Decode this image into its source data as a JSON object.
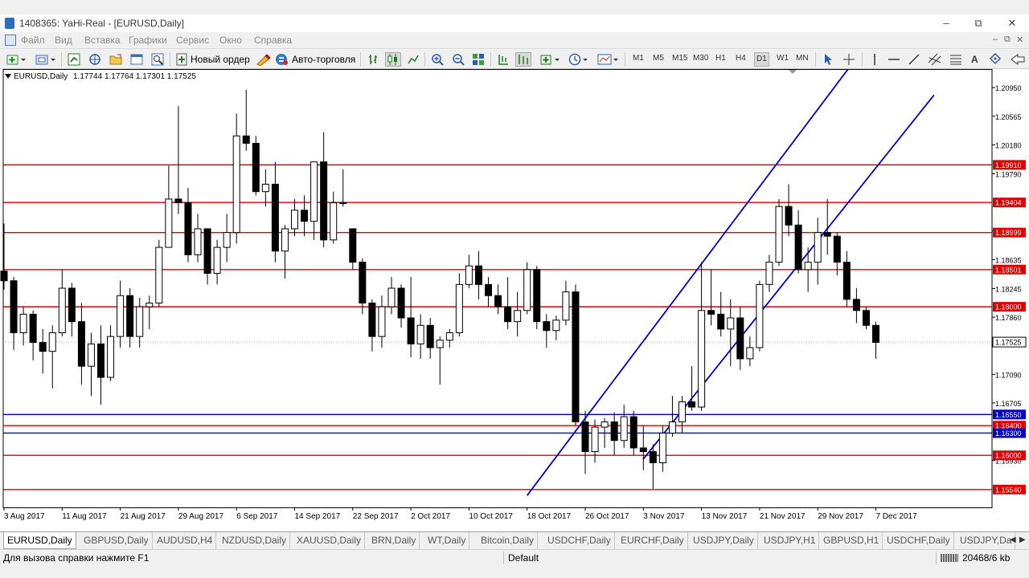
{
  "window": {
    "title": "1408365: YaHi-Real - [EURUSD,Daily]",
    "controls": [
      "–",
      "⧉",
      "✕"
    ]
  },
  "menu": [
    "Файл",
    "Вид",
    "Вставка",
    "Графики",
    "Сервис",
    "Окно",
    "Справка"
  ],
  "mdi_controls": [
    "–",
    "⧉",
    "✕"
  ],
  "toolbar": {
    "new_order_label": "Новый ордер",
    "auto_trading_label": "Авто-торговля",
    "timeframes": [
      "M1",
      "M5",
      "M15",
      "M30",
      "H1",
      "H4",
      "D1",
      "W1",
      "MN"
    ],
    "active_timeframe": "D1"
  },
  "chart_header": {
    "symbol_period": "EURUSD,Daily",
    "ohlc": "1.17744 1.17764 1.17301 1.17525"
  },
  "colors": {
    "bull_candle": "#ffffff",
    "bear_candle": "#000000",
    "support_resistance": "#e00000",
    "channel": "#0000c8",
    "current_price_label": "#0000c8"
  },
  "chart_data": {
    "type": "candlestick",
    "symbol": "EURUSD",
    "period": "Daily",
    "y_range": [
      1.153,
      1.212
    ],
    "price_axis_ticks": [
      "1.20950",
      "1.20565",
      "1.20180",
      "1.19790",
      "1.19020",
      "1.18635",
      "1.18245",
      "1.17860",
      "1.17090",
      "1.16705",
      "1.15930"
    ],
    "date_labels": [
      "3 Aug 2017",
      "11 Aug 2017",
      "21 Aug 2017",
      "29 Aug 2017",
      "6 Sep 2017",
      "14 Sep 2017",
      "22 Sep 2017",
      "2 Oct 2017",
      "10 Oct 2017",
      "18 Oct 2017",
      "26 Oct 2017",
      "3 Nov 2017",
      "13 Nov 2017",
      "21 Nov 2017",
      "29 Nov 2017",
      "7 Dec 2017"
    ],
    "horizontal_levels": [
      {
        "label": "1.19910",
        "value": 1.1991,
        "color": "red"
      },
      {
        "label": "1.19404",
        "value": 1.19404,
        "color": "red"
      },
      {
        "label": "1.18999",
        "value": 1.18999,
        "color": "red"
      },
      {
        "label": "1.18501",
        "value": 1.18501,
        "color": "red"
      },
      {
        "label": "1.18000",
        "value": 1.18,
        "color": "red"
      },
      {
        "label": "1.16550",
        "value": 1.1655,
        "color": "blue"
      },
      {
        "label": "1.16400",
        "value": 1.164,
        "color": "red"
      },
      {
        "label": "1.16300",
        "value": 1.163,
        "color": "blue"
      },
      {
        "label": "1.16000",
        "value": 1.16,
        "color": "red"
      },
      {
        "label": "1.15540",
        "value": 1.1554,
        "color": "red"
      }
    ],
    "current_price_label": "1.17525",
    "current_price": 1.17525,
    "channel_lines": [
      {
        "from": {
          "bar": 54,
          "price": 1.1546
        },
        "to": {
          "bar": 88,
          "price": 1.2135
        }
      },
      {
        "from": {
          "bar": 66,
          "price": 1.1595
        },
        "to": {
          "bar": 96,
          "price": 1.2085
        }
      }
    ],
    "candles": [
      [
        1.1848,
        1.1912,
        1.1823,
        1.1835
      ],
      [
        1.1835,
        1.184,
        1.1742,
        1.1765
      ],
      [
        1.1765,
        1.18,
        1.1748,
        1.179
      ],
      [
        1.179,
        1.1795,
        1.1728,
        1.1752
      ],
      [
        1.1752,
        1.177,
        1.171,
        1.174
      ],
      [
        1.174,
        1.1775,
        1.169,
        1.1765
      ],
      [
        1.1765,
        1.185,
        1.176,
        1.1825
      ],
      [
        1.1825,
        1.1832,
        1.176,
        1.178
      ],
      [
        1.178,
        1.1805,
        1.1695,
        1.172
      ],
      [
        1.172,
        1.1765,
        1.168,
        1.175
      ],
      [
        1.175,
        1.1775,
        1.1668,
        1.1705
      ],
      [
        1.1705,
        1.1775,
        1.17,
        1.176
      ],
      [
        1.176,
        1.1835,
        1.1745,
        1.1815
      ],
      [
        1.1815,
        1.1825,
        1.1745,
        1.176
      ],
      [
        1.176,
        1.1812,
        1.1745,
        1.18
      ],
      [
        1.18,
        1.1815,
        1.177,
        1.1805
      ],
      [
        1.1805,
        1.189,
        1.18,
        1.188
      ],
      [
        1.188,
        1.199,
        1.188,
        1.1945
      ],
      [
        1.1945,
        1.207,
        1.1925,
        1.194
      ],
      [
        1.194,
        1.196,
        1.186,
        1.187
      ],
      [
        1.187,
        1.1925,
        1.186,
        1.1905
      ],
      [
        1.1905,
        1.1905,
        1.183,
        1.1845
      ],
      [
        1.1845,
        1.189,
        1.183,
        1.188
      ],
      [
        1.188,
        1.1925,
        1.186,
        1.19
      ],
      [
        1.19,
        1.206,
        1.1885,
        1.203
      ],
      [
        1.203,
        1.2092,
        1.201,
        1.202
      ],
      [
        1.202,
        1.203,
        1.195,
        1.1955
      ],
      [
        1.1955,
        1.1985,
        1.1935,
        1.1965
      ],
      [
        1.1965,
        1.1995,
        1.186,
        1.1875
      ],
      [
        1.1875,
        1.191,
        1.1838,
        1.1905
      ],
      [
        1.1905,
        1.1945,
        1.1895,
        1.193
      ],
      [
        1.193,
        1.195,
        1.1895,
        1.1915
      ],
      [
        1.1915,
        1.1985,
        1.189,
        1.1995
      ],
      [
        1.1995,
        1.2035,
        1.188,
        1.189
      ],
      [
        1.189,
        1.1955,
        1.1885,
        1.194
      ],
      [
        1.194,
        1.1985,
        1.1935,
        1.194
      ],
      [
        1.1905,
        1.1905,
        1.185,
        1.186
      ],
      [
        1.186,
        1.1865,
        1.179,
        1.1805
      ],
      [
        1.1805,
        1.181,
        1.174,
        1.176
      ],
      [
        1.176,
        1.1815,
        1.1745,
        1.18
      ],
      [
        1.18,
        1.184,
        1.179,
        1.1825
      ],
      [
        1.1825,
        1.183,
        1.1772,
        1.1785
      ],
      [
        1.1785,
        1.184,
        1.1732,
        1.175
      ],
      [
        1.175,
        1.179,
        1.173,
        1.1775
      ],
      [
        1.1775,
        1.1785,
        1.173,
        1.1745
      ],
      [
        1.1745,
        1.176,
        1.1695,
        1.1755
      ],
      [
        1.1755,
        1.177,
        1.1745,
        1.1765
      ],
      [
        1.1765,
        1.1845,
        1.176,
        1.183
      ],
      [
        1.183,
        1.187,
        1.1825,
        1.1855
      ],
      [
        1.1855,
        1.1875,
        1.181,
        1.183
      ],
      [
        1.183,
        1.184,
        1.18,
        1.1815
      ],
      [
        1.1815,
        1.183,
        1.179,
        1.18
      ],
      [
        1.18,
        1.184,
        1.177,
        1.178
      ],
      [
        1.178,
        1.182,
        1.176,
        1.1795
      ],
      [
        1.1795,
        1.186,
        1.179,
        1.185
      ],
      [
        1.185,
        1.1855,
        1.177,
        1.178
      ],
      [
        1.178,
        1.179,
        1.1745,
        1.1768
      ],
      [
        1.1768,
        1.1788,
        1.1755,
        1.1782
      ],
      [
        1.1782,
        1.1835,
        1.1775,
        1.182
      ],
      [
        1.182,
        1.183,
        1.164,
        1.1645
      ],
      [
        1.1645,
        1.166,
        1.1575,
        1.1605
      ],
      [
        1.1605,
        1.1648,
        1.159,
        1.1638
      ],
      [
        1.1638,
        1.165,
        1.161,
        1.1645
      ],
      [
        1.1645,
        1.1658,
        1.16,
        1.162
      ],
      [
        1.162,
        1.1668,
        1.161,
        1.1652
      ],
      [
        1.1652,
        1.166,
        1.16,
        1.161
      ],
      [
        1.161,
        1.164,
        1.158,
        1.1605
      ],
      [
        1.1605,
        1.1615,
        1.1555,
        1.159
      ],
      [
        1.159,
        1.164,
        1.1578,
        1.163
      ],
      [
        1.163,
        1.168,
        1.1625,
        1.1645
      ],
      [
        1.1645,
        1.168,
        1.163,
        1.1672
      ],
      [
        1.1672,
        1.172,
        1.166,
        1.1665
      ],
      [
        1.1665,
        1.186,
        1.166,
        1.1795
      ],
      [
        1.1795,
        1.185,
        1.1775,
        1.179
      ],
      [
        1.179,
        1.182,
        1.176,
        1.177
      ],
      [
        1.177,
        1.181,
        1.172,
        1.1785
      ],
      [
        1.1785,
        1.18,
        1.1715,
        1.173
      ],
      [
        1.173,
        1.176,
        1.172,
        1.1745
      ],
      [
        1.1745,
        1.1835,
        1.174,
        1.183
      ],
      [
        1.183,
        1.187,
        1.182,
        1.186
      ],
      [
        1.186,
        1.1945,
        1.1855,
        1.1935
      ],
      [
        1.1935,
        1.1965,
        1.1895,
        1.191
      ],
      [
        1.191,
        1.193,
        1.1845,
        1.185
      ],
      [
        1.185,
        1.188,
        1.182,
        1.186
      ],
      [
        1.186,
        1.192,
        1.183,
        1.19
      ],
      [
        1.19,
        1.1945,
        1.187,
        1.1895
      ],
      [
        1.1895,
        1.19,
        1.1842,
        1.186
      ],
      [
        1.186,
        1.1875,
        1.18,
        1.181
      ],
      [
        1.181,
        1.1825,
        1.1778,
        1.1795
      ],
      [
        1.1795,
        1.18,
        1.177,
        1.1775
      ],
      [
        1.1775,
        1.178,
        1.173,
        1.1752
      ]
    ]
  },
  "tabs": [
    "EURUSD,Daily",
    "GBPUSD,Daily",
    "AUDUSD,H4",
    "NZDUSD,Daily",
    "XAUUSD,Daily",
    "BRN,Daily",
    "WT,Daily",
    "Bitcoin,Daily",
    "USDCHF,Daily",
    "EURCHF,Daily",
    "USDJPY,Daily",
    "USDJPY,H1",
    "GBPUSD,H1",
    "USDCHF,Daily",
    "USDJPY,Da"
  ],
  "active_tab": "EURUSD,Daily",
  "status": {
    "help_text": "Для вызова справки нажмите F1",
    "profile": "Default",
    "traffic": "20468/6 kb"
  }
}
